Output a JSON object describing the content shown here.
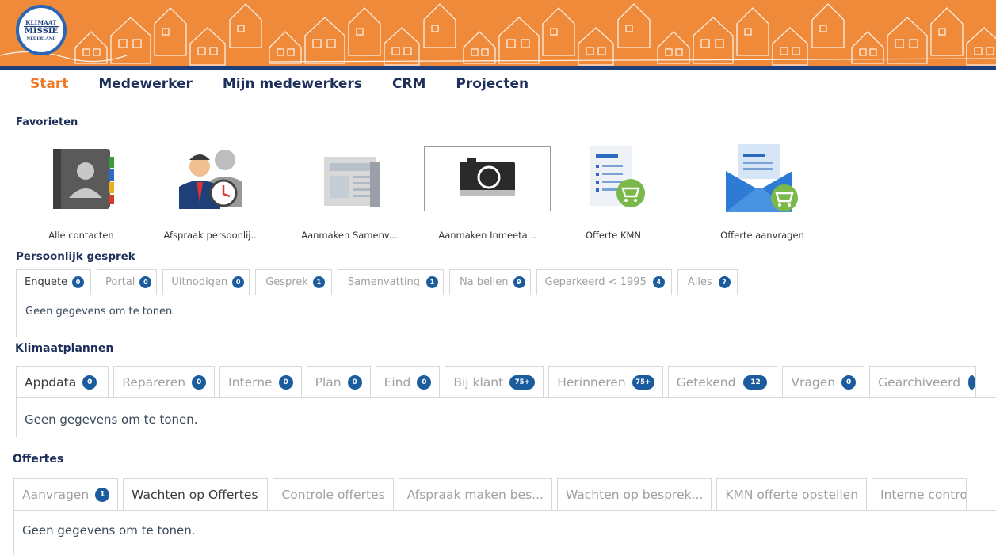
{
  "header": {
    "logo_line1": "KLIMAAT",
    "logo_line2": "MISSIE",
    "logo_line3": "NEDERLAND",
    "banner_color": "#ee8a3a",
    "line_color": "#1d3e7a"
  },
  "nav": {
    "items": [
      "Start",
      "Medewerker",
      "Mijn medewerkers",
      "CRM",
      "Projecten"
    ],
    "active": "Start"
  },
  "favorites": {
    "title": "Favorieten",
    "items": [
      {
        "label": "Alle contacten",
        "icon": "address-book-icon"
      },
      {
        "label": "Afspraak persoonlij...",
        "icon": "meeting-clock-icon"
      },
      {
        "label": "Aanmaken Samenv...",
        "icon": "newspaper-icon"
      },
      {
        "label": "Aanmaken Inmeeta...",
        "icon": "camera-icon"
      },
      {
        "label": "Offerte KMN",
        "icon": "document-cart-icon"
      },
      {
        "label": "Offerte aanvragen",
        "icon": "envelope-cart-icon"
      }
    ]
  },
  "persoonlijk": {
    "title": "Persoonlijk gesprek",
    "tabs": [
      {
        "label": "Enquete",
        "count": "0"
      },
      {
        "label": "Portal",
        "count": "0"
      },
      {
        "label": "Uitnodigen",
        "count": "0"
      },
      {
        "label": "Gesprek",
        "count": "1"
      },
      {
        "label": "Samenvatting",
        "count": "1"
      },
      {
        "label": "Na bellen",
        "count": "9"
      },
      {
        "label": "Geparkeerd < 1995",
        "count": "4"
      },
      {
        "label": "Alles",
        "count": "?"
      }
    ],
    "empty": "Geen gegevens om te tonen."
  },
  "klimaat": {
    "title": "Klimaatplannen",
    "tabs": [
      {
        "label": "Appdata",
        "count": "0"
      },
      {
        "label": "Repareren",
        "count": "0"
      },
      {
        "label": "Interne",
        "count": "0"
      },
      {
        "label": "Plan",
        "count": "0"
      },
      {
        "label": "Eind",
        "count": "0"
      },
      {
        "label": "Bij klant",
        "count": "75+"
      },
      {
        "label": "Herinneren",
        "count": "75+"
      },
      {
        "label": "Getekend",
        "count": "12"
      },
      {
        "label": "Vragen",
        "count": "0"
      },
      {
        "label": "Gearchiveerd",
        "count": ""
      }
    ],
    "empty": "Geen gegevens om te tonen."
  },
  "offertes": {
    "title": "Offertes",
    "tabs": [
      {
        "label": "Aanvragen",
        "count": "1"
      },
      {
        "label": "Wachten op Offertes",
        "count": ""
      },
      {
        "label": "Controle offertes",
        "count": ""
      },
      {
        "label": "Afspraak maken bes...",
        "count": ""
      },
      {
        "label": "Wachten op besprek...",
        "count": ""
      },
      {
        "label": "KMN offerte opstellen",
        "count": ""
      },
      {
        "label": "Interne contro",
        "count": ""
      }
    ],
    "empty": "Geen gegevens om te tonen."
  }
}
